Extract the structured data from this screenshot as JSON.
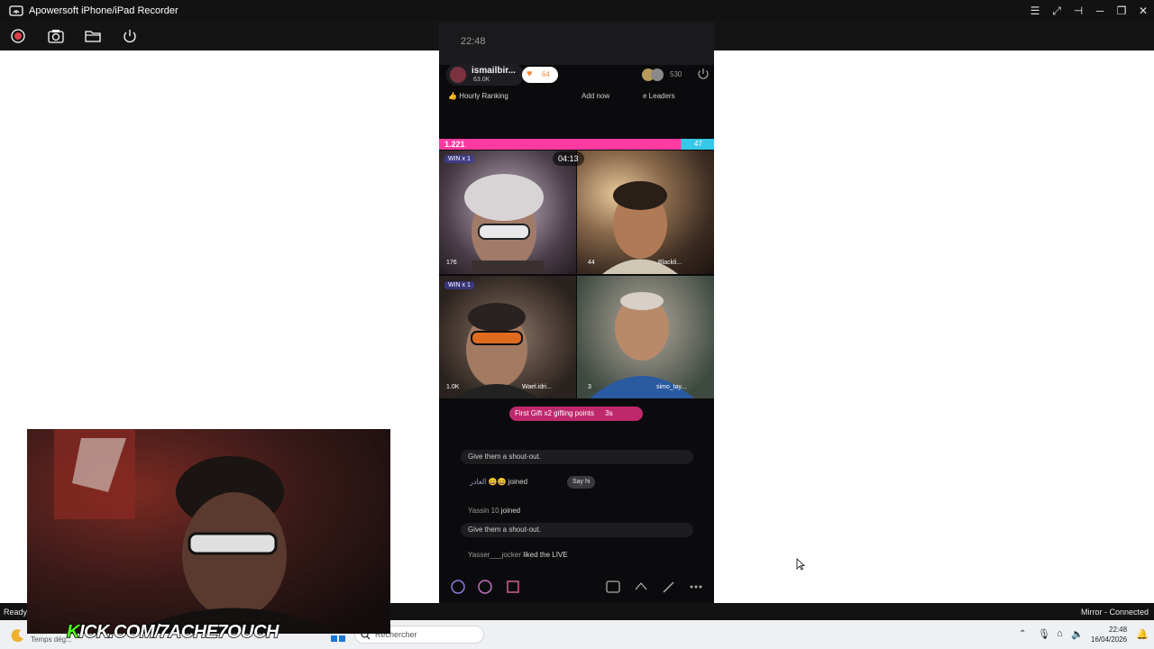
{
  "window": {
    "title": "Apowersoft iPhone/iPad Recorder"
  },
  "phone": {
    "status_time": "22:48",
    "host": {
      "name": "ismailbir...",
      "likes": "63.0K",
      "follow_count": "64"
    },
    "viewers": "530",
    "ranking_label": "Hourly Ranking",
    "add_now_label": "Add now",
    "leaders_label": "e Leaders",
    "battle": {
      "left_score": "1.221",
      "right_score": "47"
    },
    "timer": "04:13",
    "tiles": [
      {
        "badge": "WIN x 1",
        "stat": "176"
      },
      {
        "badge": "",
        "stat": "44",
        "name": "Blackli..."
      },
      {
        "badge": "WIN x 1",
        "stat": "1.0K",
        "name": "Wael.idri..."
      },
      {
        "badge": "",
        "stat": "3",
        "name": "simo_tay..."
      }
    ],
    "gift_banner": "First Gift x2 gifting points",
    "gift_banner_time": "3s",
    "chat": [
      {
        "text": "Give them a shout-out."
      },
      {
        "user": "الغادر",
        "text": "joined",
        "action": "Say hi"
      },
      {
        "user": "Yassin 10",
        "text": "joined"
      },
      {
        "text": "Give them a shout-out."
      },
      {
        "user": "Yasser___jocker",
        "text": "liked the LIVE"
      }
    ]
  },
  "status": {
    "left": "Ready",
    "right": "Mirror - Connected"
  },
  "overlay": {
    "kick_k": "K",
    "kick_rest": "ICK.COM/7ACHE7OUCH"
  },
  "taskbar": {
    "weather": "Temps dég...",
    "search_placeholder": "Rechercher",
    "time": "22:48",
    "date": "16/04/2026"
  }
}
